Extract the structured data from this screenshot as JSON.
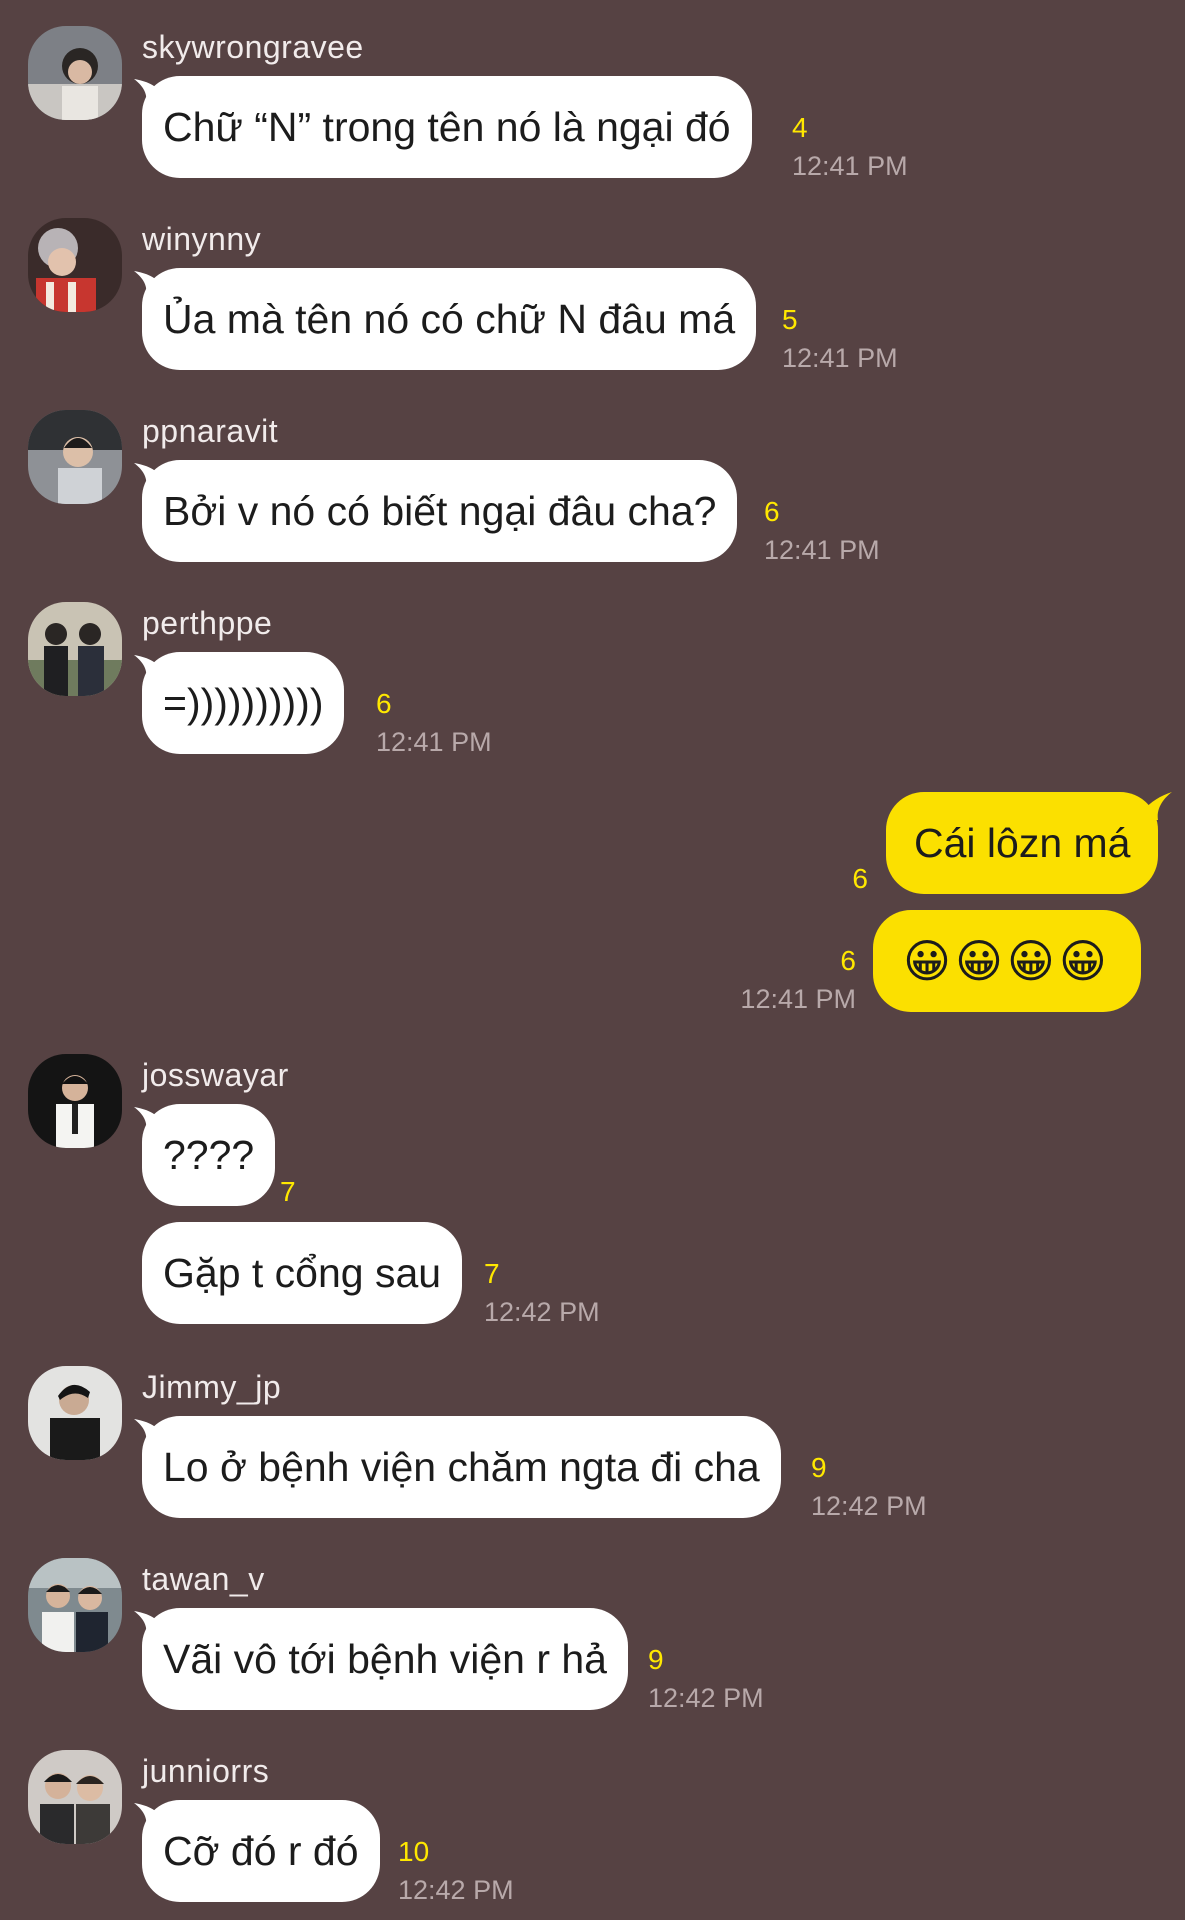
{
  "messages": [
    {
      "sender": "skywrongravee",
      "text": "Chữ “N” trong tên nó là ngại đó",
      "unread": "4",
      "time": "12:41 PM"
    },
    {
      "sender": "winynny",
      "text": "Ủa mà tên nó có chữ N đâu má",
      "unread": "5",
      "time": "12:41 PM"
    },
    {
      "sender": "ppnaravit",
      "text": "Bởi v nó có biết ngại đâu cha?",
      "unread": "6",
      "time": "12:41 PM"
    },
    {
      "sender": "perthppe",
      "text": "=))))))))))",
      "unread": "6",
      "time": "12:41 PM"
    },
    {
      "text": "Cái lôzn má",
      "unread": "6"
    },
    {
      "text": "😀😀😀😀",
      "unread": "6",
      "time": "12:41 PM"
    },
    {
      "sender": "josswayar",
      "text": "????",
      "unread": "7"
    },
    {
      "text": "Gặp t cổng sau",
      "unread": "7",
      "time": "12:42 PM"
    },
    {
      "sender": "Jimmy_jp",
      "text": "Lo ở bệnh viện chăm ngta đi cha",
      "unread": "9",
      "time": "12:42 PM"
    },
    {
      "sender": "tawan_v",
      "text": "Vãi vô tới bệnh viện r hả",
      "unread": "9",
      "time": "12:42 PM"
    },
    {
      "sender": "junniorrs",
      "text": "Cỡ đó r đó",
      "unread": "10",
      "time": "12:42 PM"
    }
  ],
  "colors": {
    "background": "#564243",
    "incoming_bubble": "#ffffff",
    "outgoing_bubble": "#fbe000",
    "unread_count": "#ffe800",
    "timestamp": "#b8a9aa",
    "sender_name": "#f1ebeb"
  }
}
